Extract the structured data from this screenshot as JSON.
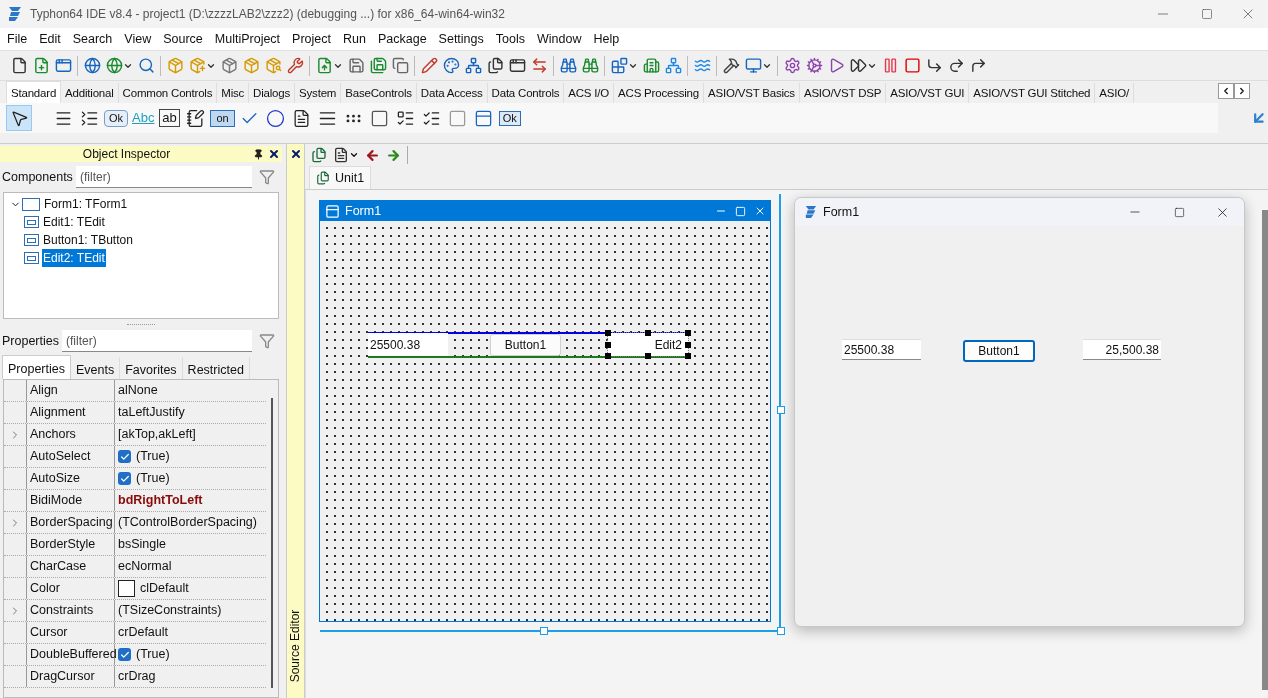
{
  "window": {
    "title": "Typhon64 IDE v8.4 - project1 (D:\\zzzzLAB2\\zzz2) (debugging ...) for x86_64-win64-win32"
  },
  "menu": [
    "File",
    "Edit",
    "Search",
    "View",
    "Source",
    "MultiProject",
    "Project",
    "Run",
    "Package",
    "Settings",
    "Tools",
    "Window",
    "Help"
  ],
  "palette": {
    "tabs": [
      {
        "label": "Standard",
        "selected": true
      },
      {
        "label": "Additional",
        "selected": false
      },
      {
        "label": "Common Controls",
        "selected": false
      },
      {
        "label": "Misc",
        "selected": false
      },
      {
        "label": "Dialogs",
        "selected": false
      },
      {
        "label": "System",
        "selected": false
      },
      {
        "label": "BaseControls",
        "selected": false
      },
      {
        "label": "Data Access",
        "selected": false
      },
      {
        "label": "Data Controls",
        "selected": false
      },
      {
        "label": "ACS I/O",
        "selected": false
      },
      {
        "label": "ACS Processing",
        "selected": false
      },
      {
        "label": "ASIO/VST Basics",
        "selected": false
      },
      {
        "label": "ASIO/VST DSP",
        "selected": false
      },
      {
        "label": "ASIO/VST GUI",
        "selected": false
      },
      {
        "label": "ASIO/VST GUI Stitched",
        "selected": false
      },
      {
        "label": "ASIO/",
        "selected": false
      }
    ],
    "items": [
      {
        "selected": true
      },
      {
        "selected": false
      },
      {
        "selected": false
      },
      {
        "selected": false,
        "caption": "Ok"
      },
      {
        "selected": false,
        "caption": "Abc"
      },
      {
        "selected": false,
        "caption": "ab"
      },
      {
        "selected": false
      },
      {
        "selected": false,
        "caption": "on"
      },
      {
        "selected": false
      },
      {
        "selected": false
      },
      {
        "selected": false
      },
      {
        "selected": false
      },
      {
        "selected": false
      },
      {
        "selected": false
      },
      {
        "selected": false
      },
      {
        "selected": false
      },
      {
        "selected": false
      },
      {
        "selected": false
      },
      {
        "selected": false,
        "caption": "Ok"
      }
    ]
  },
  "object_inspector": {
    "title": "Object Inspector",
    "components_label": "Components",
    "components_filter": {
      "placeholder": "(filter)"
    },
    "tree": [
      {
        "label": "Form1: TForm1",
        "expanded": true,
        "selected": false,
        "children": [
          {
            "label": "Edit1: TEdit",
            "selected": false
          },
          {
            "label": "Button1: TButton",
            "selected": false
          },
          {
            "label": "Edit2: TEdit",
            "selected": true
          }
        ]
      }
    ],
    "properties_label": "Properties",
    "properties_filter": {
      "placeholder": "(filter)"
    },
    "tabs": [
      {
        "label": "Properties",
        "selected": true
      },
      {
        "label": "Events",
        "selected": false
      },
      {
        "label": "Favorites",
        "selected": false
      },
      {
        "label": "Restricted",
        "selected": false
      }
    ],
    "properties": [
      {
        "name": "Align",
        "value": "alNone",
        "kind": "text",
        "expandable": false,
        "non_default": false
      },
      {
        "name": "Alignment",
        "value": "taLeftJustify",
        "kind": "text",
        "expandable": false,
        "non_default": false
      },
      {
        "name": "Anchors",
        "value": "[akTop,akLeft]",
        "kind": "text",
        "expandable": true,
        "non_default": false
      },
      {
        "name": "AutoSelect",
        "value": "(True)",
        "kind": "checkbox",
        "checked": true,
        "expandable": false,
        "non_default": false
      },
      {
        "name": "AutoSize",
        "value": "(True)",
        "kind": "checkbox",
        "checked": true,
        "expandable": false,
        "non_default": false
      },
      {
        "name": "BidiMode",
        "value": "bdRightToLeft",
        "kind": "text",
        "expandable": false,
        "non_default": true
      },
      {
        "name": "BorderSpacing",
        "value": "(TControlBorderSpacing)",
        "kind": "text",
        "expandable": true,
        "non_default": false
      },
      {
        "name": "BorderStyle",
        "value": "bsSingle",
        "kind": "text",
        "expandable": false,
        "non_default": false
      },
      {
        "name": "CharCase",
        "value": "ecNormal",
        "kind": "text",
        "expandable": false,
        "non_default": false
      },
      {
        "name": "Color",
        "value": "clDefault",
        "kind": "color",
        "color": "#ffffff",
        "expandable": false,
        "non_default": false
      },
      {
        "name": "Constraints",
        "value": "(TSizeConstraints)",
        "kind": "text",
        "expandable": true,
        "non_default": false
      },
      {
        "name": "Cursor",
        "value": "crDefault",
        "kind": "text",
        "expandable": false,
        "non_default": false
      },
      {
        "name": "DoubleBuffered",
        "value": "(True)",
        "kind": "checkbox",
        "checked": true,
        "expandable": false,
        "non_default": false
      },
      {
        "name": "DragCursor",
        "value": "crDrag",
        "kind": "text",
        "expandable": false,
        "non_default": false
      }
    ]
  },
  "side_panel": {
    "label": "Source Editor"
  },
  "source_editor": {
    "tabs": [
      {
        "label": "Unit1",
        "selected": true
      }
    ]
  },
  "designer": {
    "title": "Form1",
    "controls": [
      {
        "kind": "edit",
        "text": "25500.38",
        "right_aligned": false,
        "selected": false
      },
      {
        "kind": "button",
        "text": "Button1",
        "selected": false
      },
      {
        "kind": "edit",
        "text": "Edit2",
        "right_aligned": true,
        "selected": true
      }
    ]
  },
  "running_form": {
    "title": "Form1",
    "controls": [
      {
        "kind": "edit",
        "text": "25500.38",
        "right_aligned": false
      },
      {
        "kind": "button",
        "text": "Button1",
        "focused": true
      },
      {
        "kind": "edit",
        "text": "25,500.38",
        "right_aligned": true
      }
    ]
  }
}
